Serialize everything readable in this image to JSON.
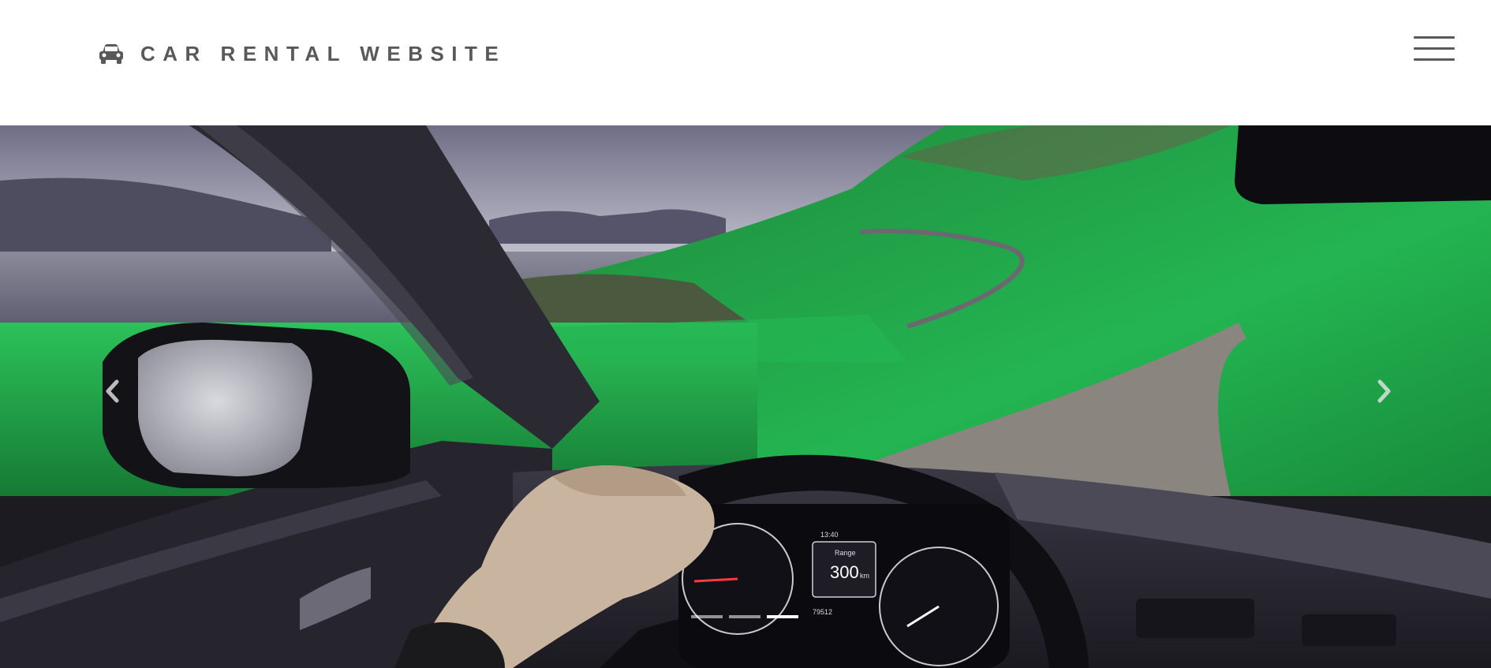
{
  "header": {
    "brand_icon": "car-icon",
    "brand_text": "CAR RENTAL WEBSITE",
    "menu_icon": "hamburger-menu-icon"
  },
  "carousel": {
    "slide_image": "Driver's view from inside a car: hand on steering wheel, side mirror, and a winding road through green hills beside a lake",
    "prev_icon": "chevron-left-icon",
    "next_icon": "chevron-right-icon",
    "indicators": [
      {
        "active": false
      },
      {
        "active": false
      },
      {
        "active": true
      }
    ],
    "dashboard": {
      "range_label": "Range",
      "range_value": "300",
      "range_unit": "km",
      "time": "13:40",
      "odometer": "79512"
    }
  },
  "colors": {
    "brand_text": "#595959",
    "menu_bars": "#5a5a5a",
    "indicator_active": "#ffffff"
  }
}
